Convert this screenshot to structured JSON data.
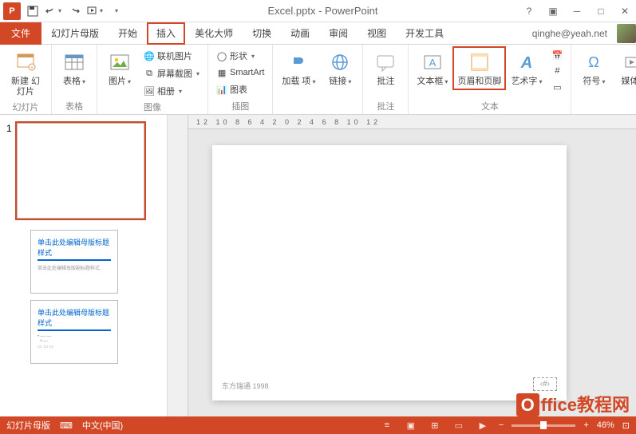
{
  "title": "Excel.pptx - PowerPoint",
  "tabs": {
    "file": "文件",
    "master": "幻灯片母版",
    "home": "开始",
    "insert": "插入",
    "beautify": "美化大师",
    "transitions": "切换",
    "animations": "动画",
    "review": "审阅",
    "view": "视图",
    "developer": "开发工具"
  },
  "user_email": "qinghe@yeah.net",
  "ribbon": {
    "groups": {
      "slides": "幻灯片",
      "tables": "表格",
      "images": "图像",
      "illustrations": "插图",
      "comments": "批注",
      "text": "文本"
    },
    "new_slide": "新建\n幻灯片",
    "table": "表格",
    "picture": "图片",
    "online_pic": "联机图片",
    "screenshot": "屏幕截图",
    "photo_album": "相册",
    "shapes": "形状",
    "smartart": "SmartArt",
    "chart": "图表",
    "addins": "加载\n项",
    "hyperlink": "链接",
    "comment": "批注",
    "textbox": "文本框",
    "header_footer": "页眉和页脚",
    "wordart": "艺术字",
    "symbol": "符号",
    "media": "媒体"
  },
  "ruler": "12 10 8 6 4 2 0 2 4 6 8 10 12",
  "thumbs": {
    "num1": "1",
    "layout_title": "单击此处编辑母版标题样式",
    "layout_sub": "单击此处编辑母版副标题样式"
  },
  "slide": {
    "footer_brand": "东方瑞通 1998",
    "page_placeholder": "‹#›"
  },
  "status": {
    "view_name": "幻灯片母版",
    "lang": "中文(中国)",
    "zoom": "46%"
  },
  "watermark": "ffice教程网"
}
